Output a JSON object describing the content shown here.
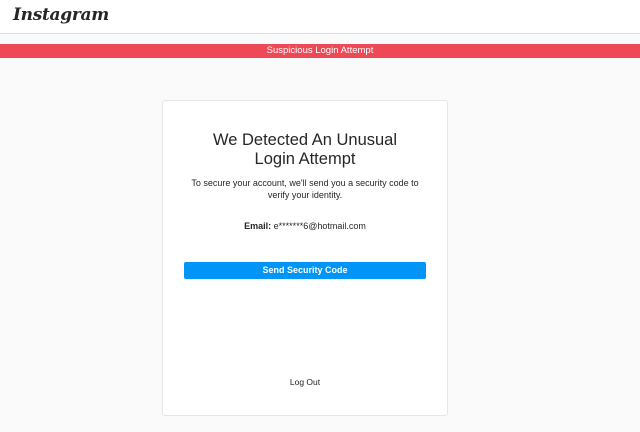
{
  "header": {
    "logo_text": "Instagram"
  },
  "alert": {
    "text": "Suspicious Login Attempt",
    "color": "#ed4956"
  },
  "card": {
    "heading": "We Detected An Unusual Login Attempt",
    "description": "To secure your account, we'll send you a security code to verify your identity.",
    "email_label": "Email:",
    "email_value": "e*******6@hotmail.com",
    "send_button_label": "Send Security Code",
    "logout_label": "Log Out",
    "accent_color": "#0095f6"
  }
}
